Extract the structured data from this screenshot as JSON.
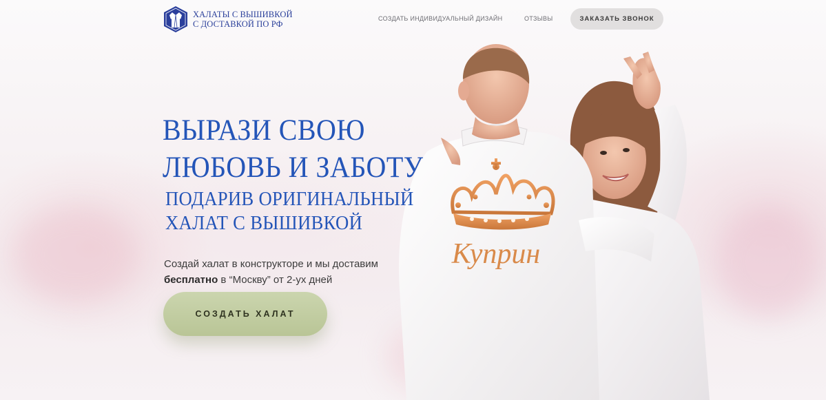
{
  "header": {
    "logo_line1": "ХАЛАТЫ С ВЫШИВКОЙ",
    "logo_line2": "С ДОСТАВКОЙ ПО РФ",
    "nav_design": "СОЗДАТЬ ИНДИВИДУАЛЬНЫЙ ДИЗАЙН",
    "nav_reviews": "ОТЗЫВЫ",
    "call_button": "ЗАКАЗАТЬ ЗВОНОК"
  },
  "hero": {
    "title_line1": "ВЫРАЗИ СВОЮ",
    "title_line2": "ЛЮБОВЬ И ЗАБОТУ",
    "subtitle_line1": "ПОДАРИВ ОРИГИНАЛЬНЫЙ",
    "subtitle_line2": "ХАЛАТ С ВЫШИВКОЙ",
    "text_line1": "Создай халат в конструкторе и мы доставим",
    "text_bold": "бесплатно",
    "text_line2_rest": " в “Москву” от 2-ух дней",
    "cta_button": "СОЗДАТЬ ХАЛАТ"
  },
  "photo": {
    "embroidery_name": "Куприн"
  },
  "colors": {
    "brand_blue": "#2455b8",
    "cta_green": "#c4cfa6",
    "call_button_gray": "#e1dfdf",
    "embroidery_gold": "#d98a4a"
  }
}
